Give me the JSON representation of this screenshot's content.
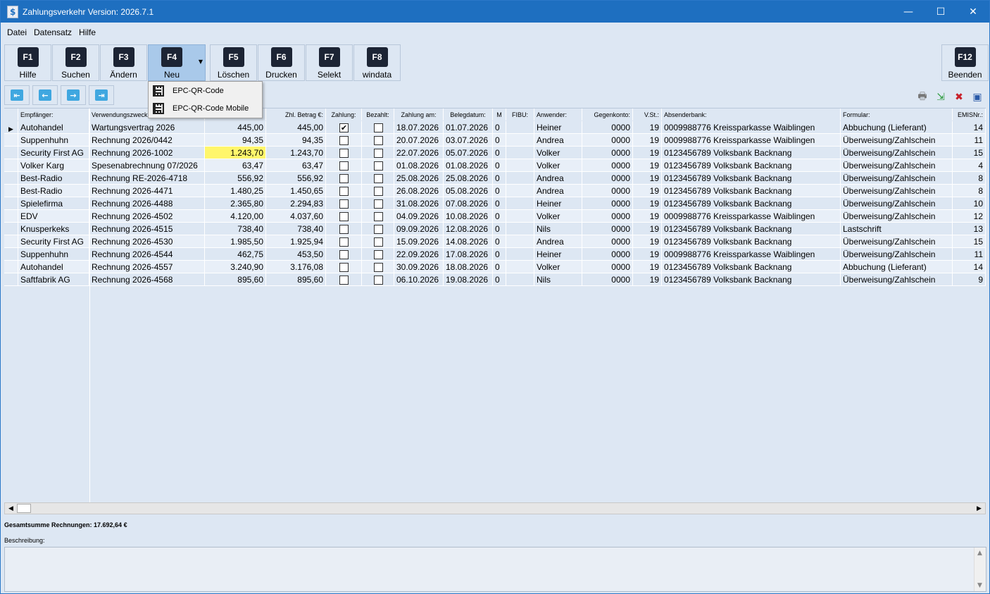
{
  "window": {
    "title": "Zahlungsverkehr Version: 2026.7.1",
    "minimize": "—",
    "maximize": "☐",
    "close": "✕"
  },
  "menu": [
    {
      "label": "Datei"
    },
    {
      "label": "Datensatz"
    },
    {
      "label": "Hilfe"
    }
  ],
  "toolbar": [
    {
      "key": "F1",
      "label": "Hilfe"
    },
    {
      "key": "F2",
      "label": "Suchen"
    },
    {
      "key": "F3",
      "label": "Ändern"
    },
    {
      "key": "F4",
      "label": "Neu"
    },
    {
      "key": "F5",
      "label": "Löschen"
    },
    {
      "key": "F6",
      "label": "Drucken"
    },
    {
      "key": "F7",
      "label": "Selekt"
    },
    {
      "key": "F8",
      "label": "windata"
    },
    {
      "key": "F12",
      "label": "Beenden"
    }
  ],
  "dropdown": [
    {
      "label": "EPC-QR-Code"
    },
    {
      "label": "EPC-QR-Code Mobile"
    }
  ],
  "nav": {
    "first": "⇤",
    "prev": "←",
    "next": "→",
    "last": "⇥"
  },
  "columns": [
    "Empfänger:",
    "Verwendungszweck:",
    "",
    "Zhl. Betrag €:",
    "Zahlung:",
    "Bezahlt:",
    "Zahlung am:",
    "Belegdatum:",
    "M",
    "FIBU:",
    "Anwender:",
    "Gegenkonto:",
    "V.St.:",
    "Absenderbank:",
    "Formular:",
    "EMISNr.:"
  ],
  "rows": [
    {
      "emp": "Autohandel",
      "zweck": "Wartungsvertrag 2026",
      "betrag": "445,00",
      "zbetrag": "445,00",
      "zahlung": "✔",
      "bezahlt": "",
      "zam": "18.07.2026",
      "beleg": "01.07.2026",
      "m": "0",
      "fibu": "",
      "anw": "Heiner",
      "gk": "0000",
      "vst": "19",
      "bank": "0009988776 Kreissparkasse Waiblingen",
      "form": "Abbuchung (Lieferant)",
      "emis": "14"
    },
    {
      "emp": "Suppenhuhn",
      "zweck": "Rechnung 2026/0442",
      "betrag": "94,35",
      "zbetrag": "94,35",
      "zahlung": "",
      "bezahlt": "",
      "zam": "20.07.2026",
      "beleg": "03.07.2026",
      "m": "0",
      "fibu": "",
      "anw": "Andrea",
      "gk": "0000",
      "vst": "19",
      "bank": "0009988776 Kreissparkasse Waiblingen",
      "form": "Überweisung/Zahlschein",
      "emis": "11"
    },
    {
      "emp": "Security First AG",
      "zweck": "Rechnung 2026-1002",
      "betrag": "1.243,70",
      "zbetrag": "1.243,70",
      "zahlung": "",
      "bezahlt": "",
      "zam": "22.07.2026",
      "beleg": "05.07.2026",
      "m": "0",
      "fibu": "",
      "anw": "Volker",
      "gk": "0000",
      "vst": "19",
      "bank": "0123456789 Volksbank Backnang",
      "form": "Überweisung/Zahlschein",
      "emis": "15"
    },
    {
      "emp": "Volker Karg",
      "zweck": "Spesenabrechnung 07/2026",
      "betrag": "63,47",
      "zbetrag": "63,47",
      "zahlung": "",
      "bezahlt": "",
      "zam": "01.08.2026",
      "beleg": "01.08.2026",
      "m": "0",
      "fibu": "",
      "anw": "Volker",
      "gk": "0000",
      "vst": "19",
      "bank": "0123456789 Volksbank Backnang",
      "form": "Überweisung/Zahlschein",
      "emis": "4"
    },
    {
      "emp": "Best-Radio",
      "zweck": "Rechnung RE-2026-4718",
      "betrag": "556,92",
      "zbetrag": "556,92",
      "zahlung": "",
      "bezahlt": "",
      "zam": "25.08.2026",
      "beleg": "25.08.2026",
      "m": "0",
      "fibu": "",
      "anw": "Andrea",
      "gk": "0000",
      "vst": "19",
      "bank": "0123456789 Volksbank Backnang",
      "form": "Überweisung/Zahlschein",
      "emis": "8"
    },
    {
      "emp": "Best-Radio",
      "zweck": "Rechnung 2026-4471",
      "betrag": "1.480,25",
      "zbetrag": "1.450,65",
      "zahlung": "",
      "bezahlt": "",
      "zam": "26.08.2026",
      "beleg": "05.08.2026",
      "m": "0",
      "fibu": "",
      "anw": "Andrea",
      "gk": "0000",
      "vst": "19",
      "bank": "0123456789 Volksbank Backnang",
      "form": "Überweisung/Zahlschein",
      "emis": "8"
    },
    {
      "emp": "Spielefirma",
      "zweck": "Rechnung 2026-4488",
      "betrag": "2.365,80",
      "zbetrag": "2.294,83",
      "zahlung": "",
      "bezahlt": "",
      "zam": "31.08.2026",
      "beleg": "07.08.2026",
      "m": "0",
      "fibu": "",
      "anw": "Heiner",
      "gk": "0000",
      "vst": "19",
      "bank": "0123456789 Volksbank Backnang",
      "form": "Überweisung/Zahlschein",
      "emis": "10"
    },
    {
      "emp": "EDV",
      "zweck": "Rechnung 2026-4502",
      "betrag": "4.120,00",
      "zbetrag": "4.037,60",
      "zahlung": "",
      "bezahlt": "",
      "zam": "04.09.2026",
      "beleg": "10.08.2026",
      "m": "0",
      "fibu": "",
      "anw": "Volker",
      "gk": "0000",
      "vst": "19",
      "bank": "0009988776 Kreissparkasse Waiblingen",
      "form": "Überweisung/Zahlschein",
      "emis": "12"
    },
    {
      "emp": "Knusperkeks",
      "zweck": "Rechnung 2026-4515",
      "betrag": "738,40",
      "zbetrag": "738,40",
      "zahlung": "",
      "bezahlt": "",
      "zam": "09.09.2026",
      "beleg": "12.08.2026",
      "m": "0",
      "fibu": "",
      "anw": "Nils",
      "gk": "0000",
      "vst": "19",
      "bank": "0123456789 Volksbank Backnang",
      "form": "Lastschrift",
      "emis": "13"
    },
    {
      "emp": "Security First AG",
      "zweck": "Rechnung 2026-4530",
      "betrag": "1.985,50",
      "zbetrag": "1.925,94",
      "zahlung": "",
      "bezahlt": "",
      "zam": "15.09.2026",
      "beleg": "14.08.2026",
      "m": "0",
      "fibu": "",
      "anw": "Andrea",
      "gk": "0000",
      "vst": "19",
      "bank": "0123456789 Volksbank Backnang",
      "form": "Überweisung/Zahlschein",
      "emis": "15"
    },
    {
      "emp": "Suppenhuhn",
      "zweck": "Rechnung 2026-4544",
      "betrag": "462,75",
      "zbetrag": "453,50",
      "zahlung": "",
      "bezahlt": "",
      "zam": "22.09.2026",
      "beleg": "17.08.2026",
      "m": "0",
      "fibu": "",
      "anw": "Heiner",
      "gk": "0000",
      "vst": "19",
      "bank": "0009988776 Kreissparkasse Waiblingen",
      "form": "Überweisung/Zahlschein",
      "emis": "11"
    },
    {
      "emp": "Autohandel",
      "zweck": "Rechnung 2026-4557",
      "betrag": "3.240,90",
      "zbetrag": "3.176,08",
      "zahlung": "",
      "bezahlt": "",
      "zam": "30.09.2026",
      "beleg": "18.08.2026",
      "m": "0",
      "fibu": "",
      "anw": "Volker",
      "gk": "0000",
      "vst": "19",
      "bank": "0123456789 Volksbank Backnang",
      "form": "Abbuchung (Lieferant)",
      "emis": "14"
    },
    {
      "emp": "Saftfabrik AG",
      "zweck": "Rechnung 2026-4568",
      "betrag": "895,60",
      "zbetrag": "895,60",
      "zahlung": "",
      "bezahlt": "",
      "zam": "06.10.2026",
      "beleg": "19.08.2026",
      "m": "0",
      "fibu": "",
      "anw": "Nils",
      "gk": "0000",
      "vst": "19",
      "bank": "0123456789 Volksbank Backnang",
      "form": "Überweisung/Zahlschein",
      "emis": "9"
    }
  ],
  "current_row_marker": "▶",
  "footer": {
    "total": "Gesamtsumme Rechnungen: 17.692,64 €",
    "desc_label": "Beschreibung:"
  },
  "colors": {
    "titlebar": "#1e6fc0",
    "background": "#dde7f3",
    "highlight": "#fff66b",
    "active_button": "#a9c9ea"
  }
}
